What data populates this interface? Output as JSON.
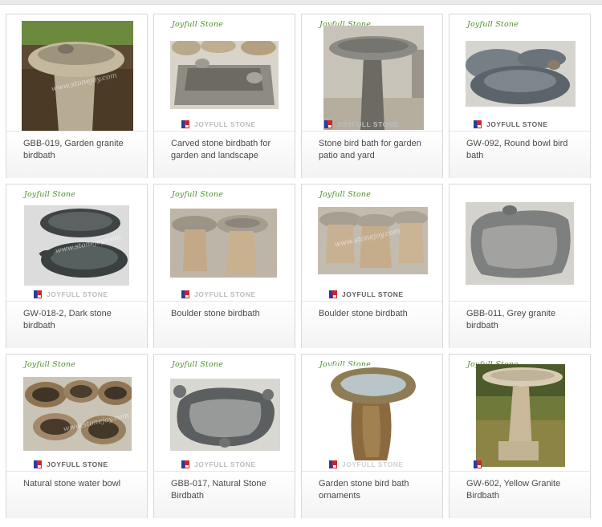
{
  "brand": {
    "logo_text": "Joyfull Stone",
    "bar_text": "JOYFULL STONE",
    "watermark": "www.stonejoy.com"
  },
  "products": [
    {
      "caption": "GBB-019, Garden granite birdbath"
    },
    {
      "caption": "Carved stone birdbath for garden and landscape"
    },
    {
      "caption": "Stone bird bath for garden patio and yard"
    },
    {
      "caption": "GW-092, Round bowl bird bath"
    },
    {
      "caption": "GW-018-2, Dark stone birdbath"
    },
    {
      "caption": "Boulder stone birdbath"
    },
    {
      "caption": "Boulder stone birdbath"
    },
    {
      "caption": "GBB-011, Grey granite birdbath"
    },
    {
      "caption": "Natural stone water bowl"
    },
    {
      "caption": "GBB-017, Natural Stone Birdbath"
    },
    {
      "caption": "Garden stone bird bath ornaments"
    },
    {
      "caption": "GW-602, Yellow Granite Birdbath"
    }
  ],
  "colors": {
    "caption_text": "#4a4a4a",
    "logo_green": "#4f8f2c",
    "card_border": "#d8d8d8"
  }
}
